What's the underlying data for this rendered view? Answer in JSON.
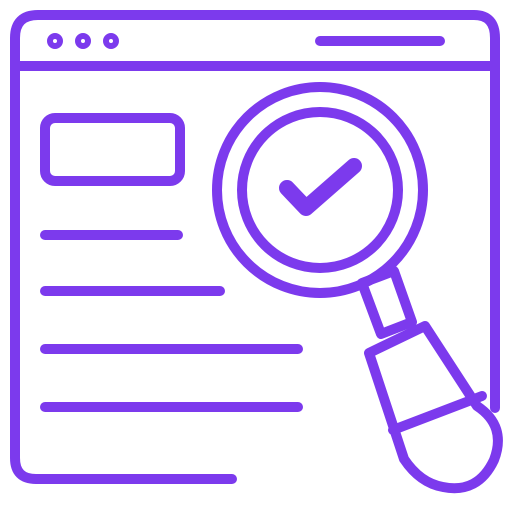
{
  "colors": {
    "stroke": "#7c3aed",
    "background": "#ffffff"
  },
  "icon": {
    "name": "web-page-search-check-icon",
    "window": {
      "controls": [
        "dot",
        "dot",
        "dot"
      ],
      "title_bar_line": true
    },
    "content": {
      "header_box": true,
      "text_lines": 4
    },
    "magnifier": {
      "badge": "check-icon"
    }
  }
}
